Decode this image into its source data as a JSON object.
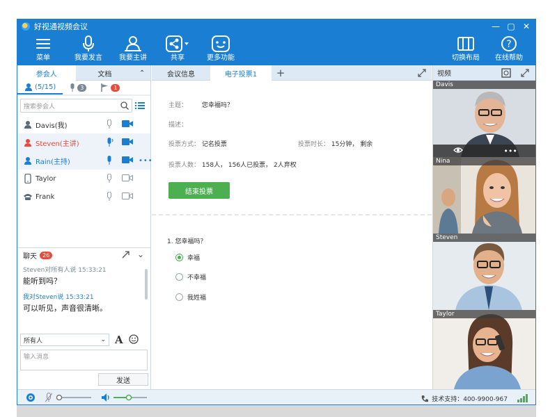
{
  "window": {
    "title": "好视通视频会议"
  },
  "toolbar": {
    "menu": "菜单",
    "speak": "我要发言",
    "host": "我要主讲",
    "share": "共享",
    "more": "更多功能",
    "layout": "切换布局",
    "help": "在线帮助"
  },
  "left_tabs": {
    "participants": "参会人",
    "docs": "文档"
  },
  "participant_tabs": {
    "count": "(5/15)",
    "mic_badge": "3",
    "hand_badge": "1"
  },
  "search": {
    "placeholder": "搜索参会人"
  },
  "participants": [
    {
      "name": "Davis(我)",
      "color": "#333333"
    },
    {
      "name": "Steven(主讲)",
      "color": "#e84b3c"
    },
    {
      "name": "Rain(主持)",
      "color": "#1a7ed3"
    },
    {
      "name": "Taylor",
      "color": "#333333"
    },
    {
      "name": "Frank",
      "color": "#333333"
    }
  ],
  "chat": {
    "title": "聊天",
    "unread": "26",
    "messages": [
      {
        "meta": "Steven对所有人说  15:33:21",
        "text": "能听到吗？"
      },
      {
        "meta": "我对Steven说  15:33:21",
        "text": "可以听见，声音很清晰。"
      }
    ],
    "target": "所有人",
    "input_placeholder": "输入消息",
    "send": "发送"
  },
  "center_tabs": {
    "info": "会议信息",
    "vote": "电子投票1"
  },
  "vote": {
    "subject_label": "主题：",
    "subject": "您幸福吗？",
    "desc_label": "描述：",
    "mode_label": "投票方式：",
    "mode": "记名投票",
    "duration_label": "投票时长：",
    "duration": "15分钟， 剩余",
    "count_label": "投票人数：",
    "count": "158人， 156人已投票， 2人弃权",
    "end_button": "结束投票",
    "question": "1. 您幸福吗？",
    "options": [
      "幸福",
      "不幸福",
      "我姓福"
    ]
  },
  "video": {
    "title": "视频",
    "tiles": [
      {
        "name": "Davis"
      },
      {
        "name": "Nina"
      },
      {
        "name": "Steven"
      },
      {
        "name": "Taylor"
      }
    ]
  },
  "status": {
    "support": "技术支持：400-9900-967"
  },
  "colors": {
    "accent": "#1a7ed3",
    "green": "#4caf50",
    "red": "#e84b3c"
  }
}
